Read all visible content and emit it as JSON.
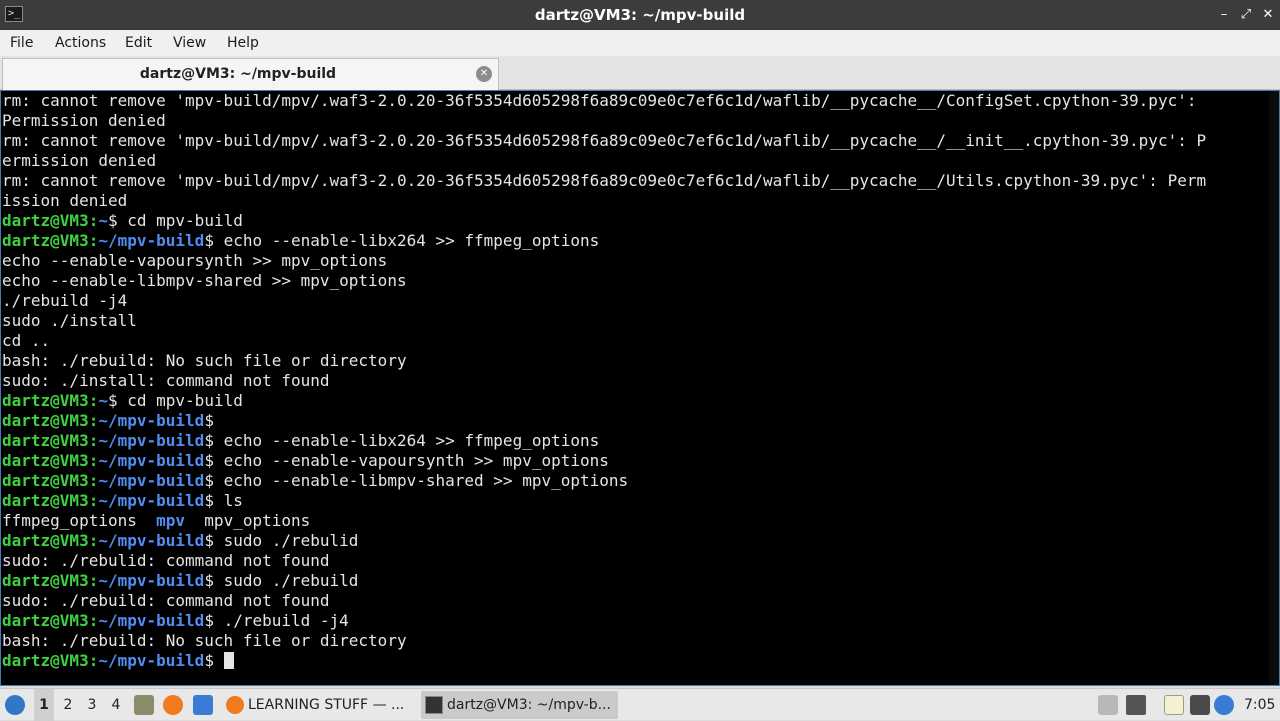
{
  "window": {
    "title": "dartz@VM3: ~/mpv-build",
    "icon_glyph": ">_",
    "buttons": {
      "minimize": "–",
      "maximize": "⤢",
      "close": "✕"
    }
  },
  "menu": [
    "File",
    "Actions",
    "Edit",
    "View",
    "Help"
  ],
  "tab": {
    "label": "dartz@VM3: ~/mpv-build",
    "close_glyph": "✕"
  },
  "terminal": {
    "prompt_user": "dartz@VM3",
    "prompt_home": "~",
    "prompt_build": "~/mpv-build",
    "lines": [
      "rm: cannot remove 'mpv-build/mpv/.waf3-2.0.20-36f5354d605298f6a89c09e0c7ef6c1d/waflib/__pycache__/ConfigSet.cpython-39.pyc':",
      "Permission denied",
      "rm: cannot remove 'mpv-build/mpv/.waf3-2.0.20-36f5354d605298f6a89c09e0c7ef6c1d/waflib/__pycache__/__init__.cpython-39.pyc': P",
      "ermission denied",
      "rm: cannot remove 'mpv-build/mpv/.waf3-2.0.20-36f5354d605298f6a89c09e0c7ef6c1d/waflib/__pycache__/Utils.cpython-39.pyc': Perm",
      "ission denied",
      "$ cd mpv-build",
      "$ echo --enable-libx264 >> ffmpeg_options",
      "echo --enable-vapoursynth >> mpv_options",
      "echo --enable-libmpv-shared >> mpv_options",
      "./rebuild -j4",
      "sudo ./install",
      "cd ..",
      "bash: ./rebuild: No such file or directory",
      "sudo: ./install: command not found",
      "$ cd mpv-build",
      "$ ",
      "$ echo --enable-libx264 >> ffmpeg_options",
      "$ echo --enable-vapoursynth >> mpv_options",
      "$ echo --enable-libmpv-shared >> mpv_options",
      "$ ls",
      "ffmpeg_options  ",
      "mpv",
      "  mpv_options",
      "$ sudo ./rebulid",
      "sudo: ./rebulid: command not found",
      "$ sudo ./rebuild",
      "sudo: ./rebuild: command not found",
      "$ ./rebuild -j4",
      "bash: ./rebuild: No such file or directory",
      "$ "
    ]
  },
  "taskbar": {
    "desktops": [
      "1",
      "2",
      "3",
      "4"
    ],
    "tasks": [
      {
        "label": "LEARNING STUFF — ..."
      },
      {
        "label": "dartz@VM3: ~/mpv-b..."
      }
    ],
    "clock": "7:05"
  }
}
